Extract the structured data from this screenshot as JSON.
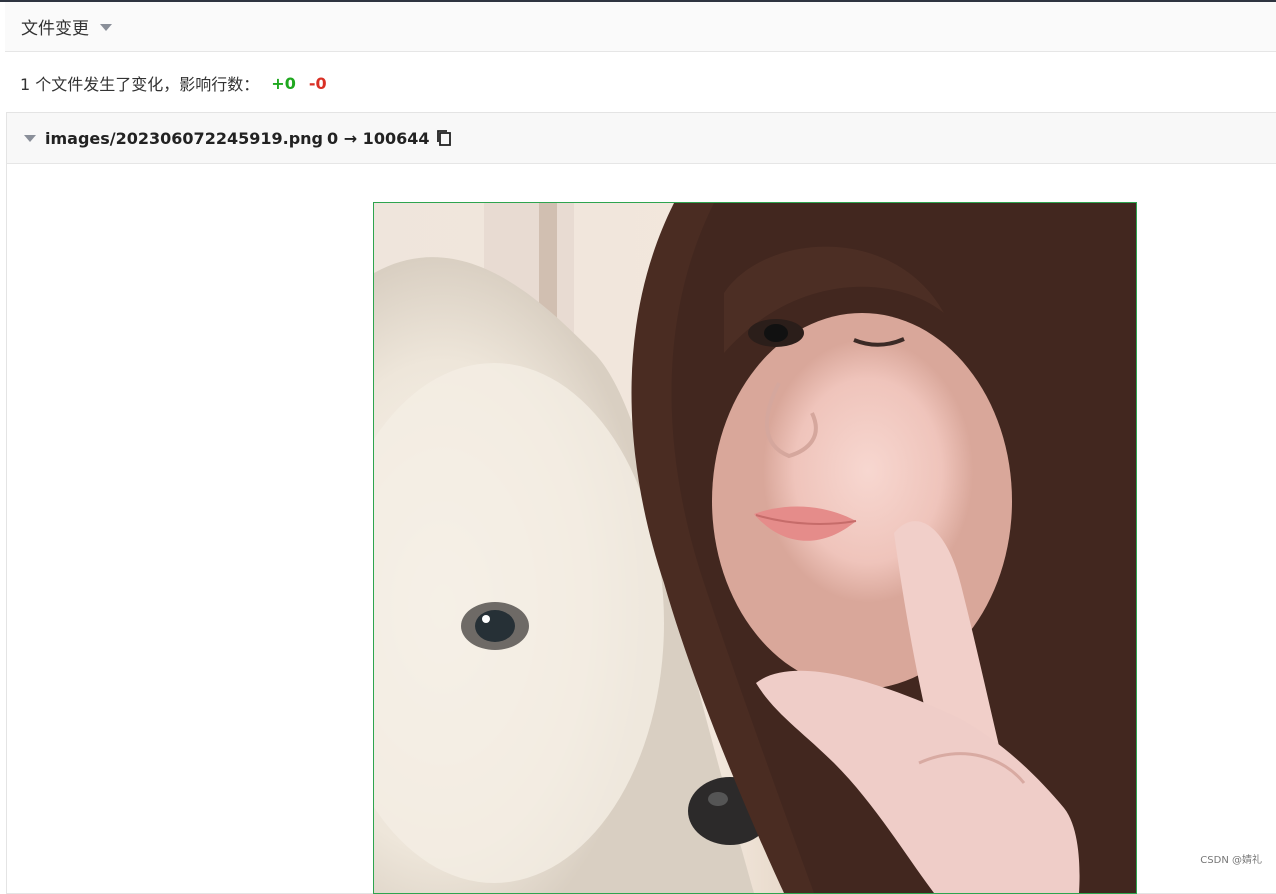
{
  "section": {
    "title": "文件变更"
  },
  "summary": {
    "text": "1 个文件发生了变化，影响行数：",
    "added": "+0",
    "removed": "-0"
  },
  "file": {
    "name": "images/202306072245919.png",
    "mode_change": "0 → 100644"
  },
  "watermark": "CSDN @婧礼",
  "icons": {
    "section_toggle": "chevron-down-icon",
    "file_toggle": "chevron-down-icon",
    "copy": "copy-icon"
  },
  "colors": {
    "added": "#1fa81f",
    "removed": "#d93025",
    "image_border": "#2ea44f"
  }
}
